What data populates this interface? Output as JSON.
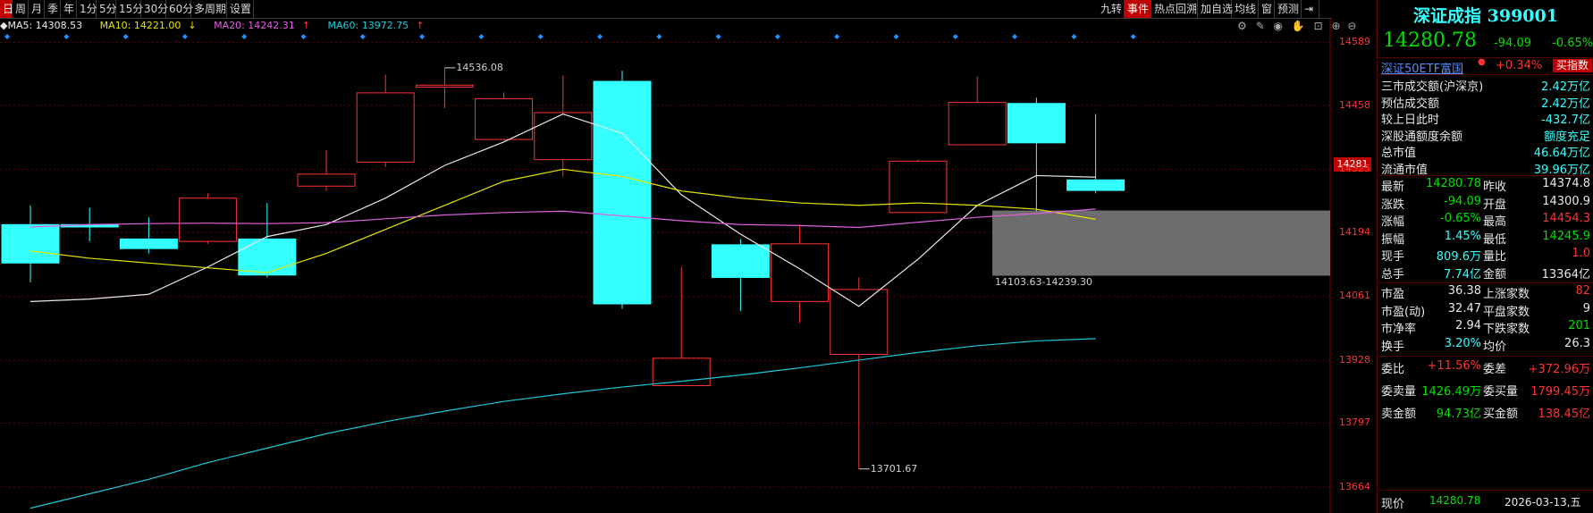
{
  "toolbar": {
    "left_items": [
      "日",
      "周",
      "月",
      "季",
      "年",
      "1分",
      "5分",
      "15分",
      "30分",
      "60分",
      "多周期",
      "设置"
    ],
    "right_items": [
      "九转",
      "事件",
      "热点回溯",
      "加自选",
      "均线",
      "窗",
      "预测"
    ]
  },
  "ma_legend": {
    "ma5": "MA5: 14308.53",
    "ma10": "MA10: 14221.00",
    "ma20": "MA20: 14242.31",
    "ma60": "MA60: 13972.75",
    "ma10_arrow": "↓",
    "ma20_arrow": "↑",
    "ma60_arrow": "↑"
  },
  "colors": {
    "up": "#ff3333",
    "down": "#33ffff",
    "ma5": "#e8e8e8",
    "ma10": "#e6e600",
    "ma20": "#e060e0",
    "ma60": "#1cc8d8",
    "grid": "#5a0000"
  },
  "chart_data": {
    "type": "candlestick",
    "y_ticks": [
      14589,
      14458,
      14325,
      14194,
      14061,
      13928,
      13797,
      13664
    ],
    "ylim": [
      13610,
      14640
    ],
    "current_price_tag": "14281",
    "candles": [
      {
        "o": 14210,
        "c": 14130,
        "h": 14250,
        "l": 14090
      },
      {
        "o": 14210,
        "c": 14205,
        "h": 14245,
        "l": 14175
      },
      {
        "o": 14180,
        "c": 14160,
        "h": 14225,
        "l": 14150
      },
      {
        "o": 14175,
        "c": 14265,
        "h": 14275,
        "l": 14170
      },
      {
        "o": 14180,
        "c": 14105,
        "h": 14255,
        "l": 14100
      },
      {
        "o": 14290,
        "c": 14315,
        "h": 14365,
        "l": 14280
      },
      {
        "o": 14340,
        "c": 14484,
        "h": 14522,
        "l": 14330
      },
      {
        "o": 14496,
        "c": 14500,
        "h": 14536.08,
        "l": 14452
      },
      {
        "o": 14387,
        "c": 14472,
        "h": 14485,
        "l": 14385
      },
      {
        "o": 14345,
        "c": 14443,
        "h": 14520,
        "l": 14310
      },
      {
        "o": 14508,
        "c": 14045,
        "h": 14530,
        "l": 14035
      },
      {
        "o": 13875,
        "c": 13932,
        "h": 14122,
        "l": 13875
      },
      {
        "o": 14168,
        "c": 14100,
        "h": 14180,
        "l": 14030
      },
      {
        "o": 14050,
        "c": 14170,
        "h": 14210,
        "l": 14005
      },
      {
        "o": 13940,
        "c": 14075,
        "h": 14100,
        "l": 13701.67
      },
      {
        "o": 14235,
        "c": 14342,
        "h": 14345,
        "l": 14235
      },
      {
        "o": 14376,
        "c": 14464,
        "h": 14518,
        "l": 14376
      },
      {
        "o": 14462,
        "c": 14380,
        "h": 14474,
        "l": 14238
      },
      {
        "o": 14303,
        "c": 14281,
        "h": 14440,
        "l": 14275
      }
    ],
    "series": [
      {
        "name": "MA5",
        "values": [
          14050,
          14055,
          14065,
          14122,
          14185,
          14210,
          14265,
          14333,
          14382,
          14440,
          14400,
          14272,
          14190,
          14118,
          14040,
          14138,
          14250,
          14312,
          14308.53
        ]
      },
      {
        "name": "MA10",
        "values": [
          14155,
          14140,
          14130,
          14120,
          14110,
          14150,
          14200,
          14250,
          14300,
          14325,
          14310,
          14280,
          14265,
          14255,
          14250,
          14255,
          14250,
          14242,
          14221.0
        ]
      },
      {
        "name": "MA20",
        "values": [
          14205,
          14210,
          14212,
          14213,
          14212,
          14214,
          14222,
          14230,
          14235,
          14238,
          14228,
          14218,
          14210,
          14208,
          14204,
          14215,
          14225,
          14233,
          14242.31
        ]
      },
      {
        "name": "MA60",
        "values": [
          13620,
          13650,
          13680,
          13715,
          13745,
          13775,
          13800,
          13822,
          13842,
          13858,
          13872,
          13884,
          13897,
          13912,
          13928,
          13944,
          13958,
          13968,
          13972.75
        ]
      }
    ],
    "annotations": {
      "high_label": "14536.08",
      "low_label": "13701.67",
      "range_label": "14103.63-14239.30",
      "range_low": 14103.63,
      "range_high": 14239.3
    }
  },
  "quote": {
    "title": "深证成指 399001",
    "price": "14280.78",
    "change": "-94.09",
    "change_pct": "-0.65%",
    "etf_name": "深证50ETF富国",
    "etf_pct": "+0.34%",
    "buy_index_btn": "买指数",
    "rows1": [
      {
        "k": "三市成交额(沪深京)",
        "v": "2.42万亿"
      },
      {
        "k": "预估成交额",
        "v": "2.42万亿"
      },
      {
        "k": "较上日此时",
        "v": "-432.7亿"
      },
      {
        "k": "深股通额度余额",
        "v": "额度充足"
      },
      {
        "k": "总市值",
        "v": "46.64万亿"
      },
      {
        "k": "流通市值",
        "v": "39.96万亿"
      }
    ],
    "rows2": [
      {
        "k1": "最新",
        "v1": "14280.78",
        "k2": "昨收",
        "v2": "14374.8"
      },
      {
        "k1": "涨跌",
        "v1": "-94.09",
        "k2": "开盘",
        "v2": "14300.9"
      },
      {
        "k1": "涨幅",
        "v1": "-0.65%",
        "k2": "最高",
        "v2": "14454.3"
      },
      {
        "k1": "振幅",
        "v1": "1.45%",
        "k2": "最低",
        "v2": "14245.9"
      },
      {
        "k1": "现手",
        "v1": "809.6万",
        "k2": "量比",
        "v2": "1.0"
      },
      {
        "k1": "总手",
        "v1": "7.74亿",
        "k2": "金额",
        "v2": "13364亿"
      }
    ],
    "rows3": [
      {
        "k1": "市盈",
        "v1": "36.38",
        "k2": "上涨家数",
        "v2": "82"
      },
      {
        "k1": "市盈(动)",
        "v1": "32.47",
        "k2": "平盘家数",
        "v2": "9"
      },
      {
        "k1": "市净率",
        "v1": "2.94",
        "k2": "下跌家数",
        "v2": "201"
      },
      {
        "k1": "换手",
        "v1": "3.20%",
        "k2": "均价",
        "v2": "26.3"
      }
    ],
    "rows4": [
      {
        "k1": "委比",
        "v1": "+11.56%",
        "k2": "委差",
        "v2": "+372.96万"
      },
      {
        "k1": "委卖量",
        "v1": "1426.49万",
        "k2": "委买量",
        "v2": "1799.45万"
      },
      {
        "k1": "卖金额",
        "v1": "94.73亿",
        "k2": "买金额",
        "v2": "138.45亿"
      }
    ],
    "bottom": {
      "k": "现价",
      "v": "14280.78",
      "date": "2026-03-13,五"
    }
  }
}
